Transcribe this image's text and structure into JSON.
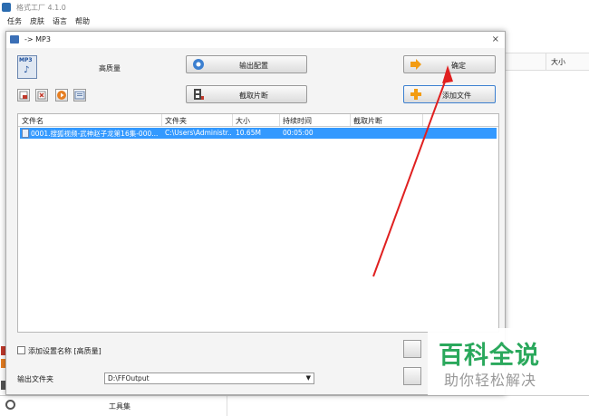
{
  "app": {
    "title": "格式工厂 4.1.0"
  },
  "menu": [
    "任务",
    "皮肤",
    "语言",
    "帮助"
  ],
  "background_list": {
    "size_header": "大小"
  },
  "bottom_bar": {
    "tools_label": "工具集"
  },
  "dialog": {
    "title": "-> MP3",
    "close_glyph": "×",
    "quality": "高质量",
    "buttons": {
      "output_config": "输出配置",
      "clip": "截取片断",
      "ok": "确定",
      "add_file": "添加文件"
    },
    "list": {
      "columns": [
        "文件名",
        "文件夹",
        "大小",
        "持续时间",
        "截取片断"
      ],
      "rows": [
        {
          "filename": "0001.搜狐视频-武神赵子龙第16集-000...",
          "folder": "C:\\Users\\Administr...",
          "size": "10.65M",
          "duration": "00:05:00",
          "clip": ""
        }
      ]
    },
    "add_setting_name": "添加设置名称 [高质量]",
    "output_folder_label": "输出文件夹",
    "output_folder_value": "D:\\FFOutput"
  },
  "watermark": {
    "title": "百科全说",
    "subtitle": "助你轻松解决"
  },
  "colors": {
    "selection": "#3399ff",
    "arrow": "#e02020",
    "watermark": "#2aa85c"
  }
}
